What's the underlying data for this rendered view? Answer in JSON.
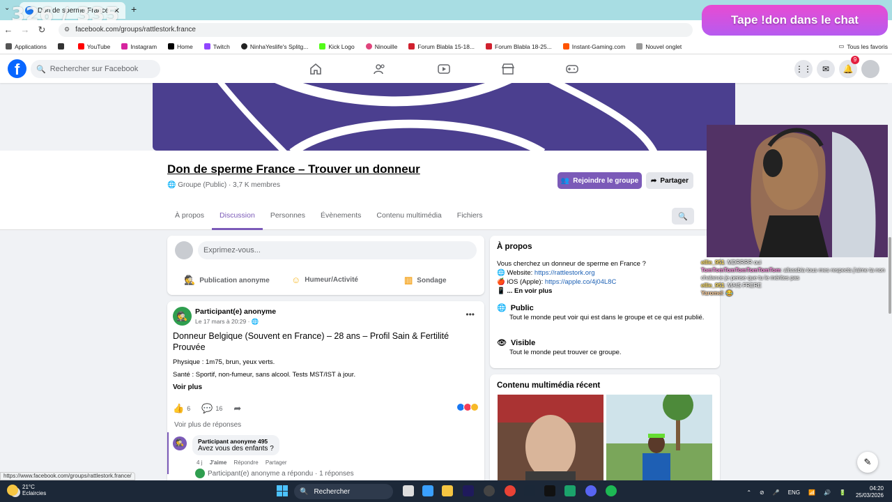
{
  "browser": {
    "tab_title": "Don de sperme France - Tro",
    "url": "facebook.com/groups/rattlestork.france",
    "bookmarks": [
      "Applications",
      "YouTube",
      "Instagram",
      "Home",
      "Twitch",
      "NinhaYeslife's Splitg...",
      "Kick Logo",
      "Ninouille",
      "Forum Blabla 15-18...",
      "Forum Blabla 18-25...",
      "Instant-Gaming.com",
      "Nouvel onglet"
    ],
    "bookmarks_right": "Tous les favoris",
    "status_url": "https://www.facebook.com/groups/rattlestork.france/"
  },
  "overlay": {
    "counter": "326 / 335",
    "banner": "Tape !don dans le chat",
    "chat": [
      {
        "user": "ellie_951",
        "text": ": MDRRRR oui"
      },
      {
        "user": "TomTomTomTomTomTomTom",
        "text": ": alisssbia tous mes respects j'aime ta non chalance je pense que tu le mérites pas"
      },
      {
        "user": "ellie_951",
        "text": ": MAIS FRERE"
      },
      {
        "user": "Yaromel",
        "text": ": 😂"
      }
    ]
  },
  "fb": {
    "search_placeholder": "Rechercher sur Facebook",
    "notif_count": "9"
  },
  "group": {
    "title": "Don de sperme France – Trouver un donneur",
    "subtitle": "Groupe (Public) · 3,7 K membres",
    "join": "Rejoindre le groupe",
    "share": "Partager",
    "tabs": [
      "À propos",
      "Discussion",
      "Personnes",
      "Évènements",
      "Contenu multimédia",
      "Fichiers"
    ]
  },
  "composer": {
    "placeholder": "Exprimez-vous...",
    "actions": [
      "Publication anonyme",
      "Humeur/Activité",
      "Sondage"
    ]
  },
  "post": {
    "author": "Participant(e) anonyme",
    "date": "Le 17 mars à 20:29 ·",
    "title": "Donneur Belgique (Souvent en France) – 28 ans – Profil Sain & Fertilité Prouvée",
    "line1": "Physique : 1m75, brun, yeux verts.",
    "line2": "Santé : Sportif, non-fumeur, sans alcool. Tests MST/IST à jour.",
    "see_more": "Voir plus",
    "likes": "6",
    "comments": "16",
    "more_replies": "Voir plus de réponses",
    "comment": {
      "author": "Participant anonyme 495",
      "text": "Avez vous des enfants ?",
      "time": "4 j",
      "like": "J'aime",
      "reply": "Répondre",
      "share": "Partager",
      "replied": "Participant(e) anonyme a répondu · 1 réponses"
    }
  },
  "about": {
    "heading": "À propos",
    "intro": "Vous cherchez un donneur de sperme en France ?",
    "website_label": "Website:",
    "website": "https://rattlestork.org",
    "ios_label": "iOS (Apple):",
    "ios": "https://apple.co/4j04L8C",
    "more": "... En voir plus",
    "public_title": "Public",
    "public_desc": "Tout le monde peut voir qui est dans le groupe et ce qui est publié.",
    "visible_title": "Visible",
    "visible_desc": "Tout le monde peut trouver ce groupe."
  },
  "media": {
    "heading": "Contenu multimédia récent"
  },
  "taskbar": {
    "temp": "21°C",
    "weather": "Eclaircies",
    "search": "Rechercher",
    "lang": "ENG",
    "time": "04:20",
    "date": "25/03/2026"
  }
}
